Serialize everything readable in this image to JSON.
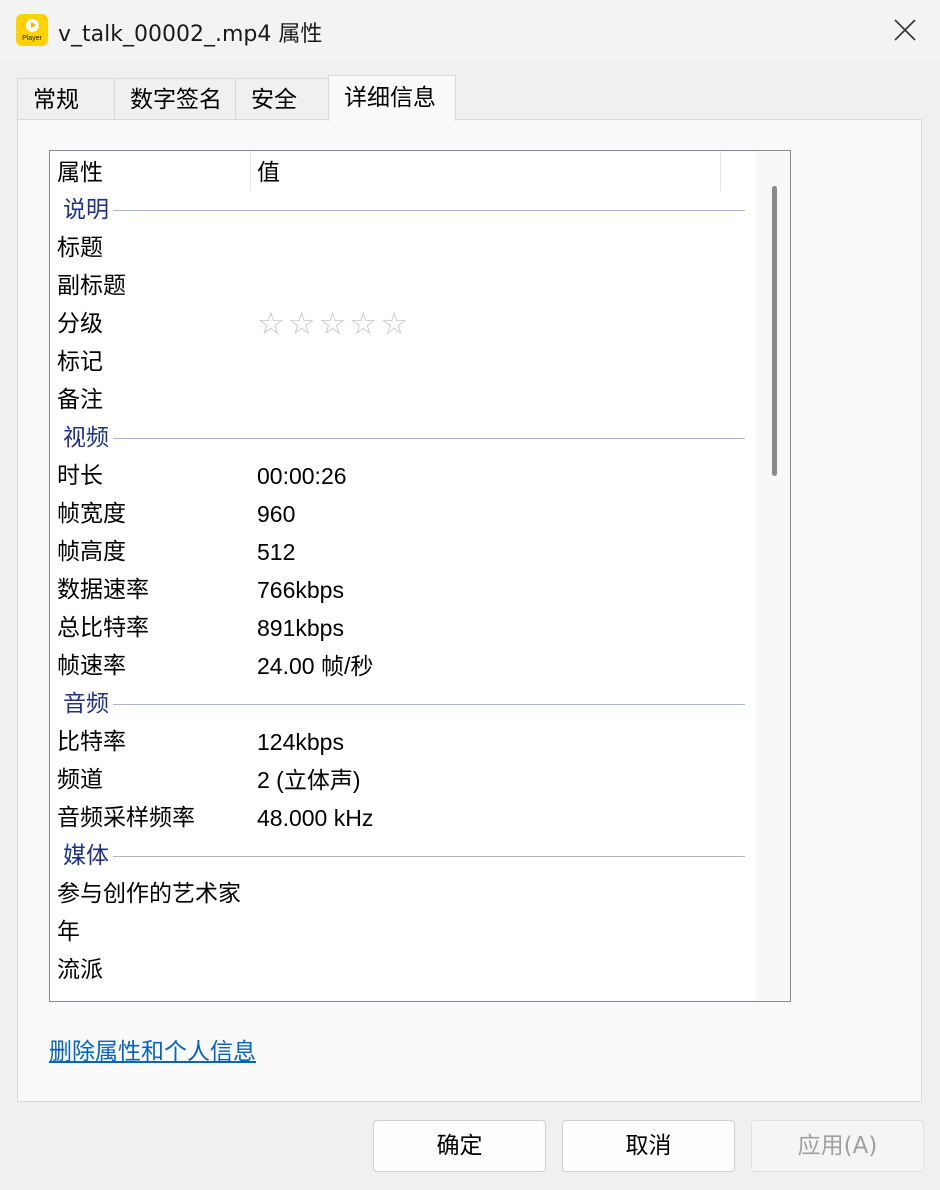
{
  "window": {
    "title": "v_talk_00002_.mp4 属性",
    "app_icon_label": "Player"
  },
  "tabs": [
    {
      "label": "常规",
      "active": false
    },
    {
      "label": "数字签名",
      "active": false
    },
    {
      "label": "安全",
      "active": false
    },
    {
      "label": "详细信息",
      "active": true
    }
  ],
  "details": {
    "columns": {
      "property": "属性",
      "value": "值"
    },
    "groups": [
      {
        "name": "说明",
        "rows": [
          {
            "name": "标题",
            "value": ""
          },
          {
            "name": "副标题",
            "value": ""
          },
          {
            "name": "分级",
            "value": "",
            "rating_stars": 0,
            "rating_max": 5
          },
          {
            "name": "标记",
            "value": ""
          },
          {
            "name": "备注",
            "value": ""
          }
        ]
      },
      {
        "name": "视频",
        "rows": [
          {
            "name": "时长",
            "value": "00:00:26"
          },
          {
            "name": "帧宽度",
            "value": "960"
          },
          {
            "name": "帧高度",
            "value": "512"
          },
          {
            "name": "数据速率",
            "value": "766kbps"
          },
          {
            "name": "总比特率",
            "value": "891kbps"
          },
          {
            "name": "帧速率",
            "value": "24.00 帧/秒"
          }
        ]
      },
      {
        "name": "音频",
        "rows": [
          {
            "name": "比特率",
            "value": "124kbps"
          },
          {
            "name": "频道",
            "value": "2 (立体声)"
          },
          {
            "name": "音频采样频率",
            "value": "48.000 kHz"
          }
        ]
      },
      {
        "name": "媒体",
        "rows": [
          {
            "name": "参与创作的艺术家",
            "value": ""
          },
          {
            "name": "年",
            "value": ""
          },
          {
            "name": "流派",
            "value": ""
          }
        ]
      }
    ]
  },
  "remove_link": "删除属性和个人信息",
  "buttons": {
    "ok": "确定",
    "cancel": "取消",
    "apply": "应用(A)"
  }
}
